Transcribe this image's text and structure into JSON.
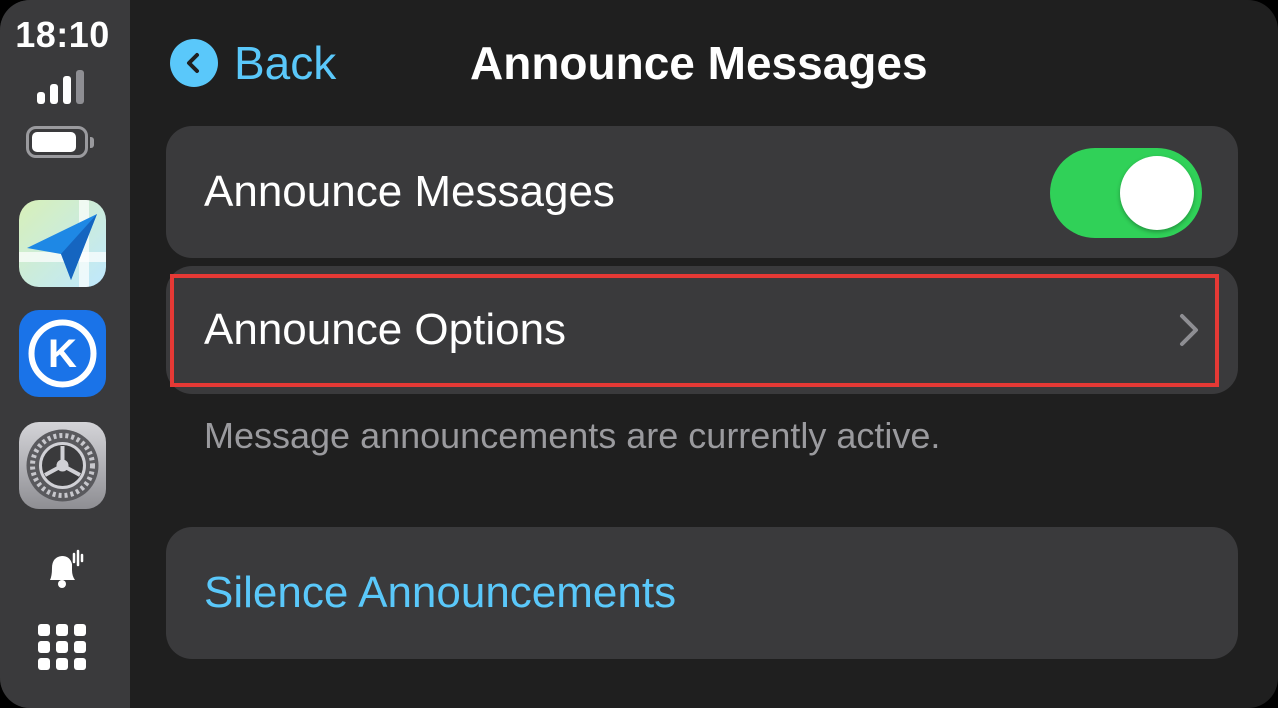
{
  "status": {
    "time": "18:10"
  },
  "sidebar": {
    "apps": [
      {
        "icon": "navigation-app-icon"
      },
      {
        "icon": "kiwi-k-app-icon"
      },
      {
        "icon": "settings-gear-app-icon"
      }
    ],
    "notification_icon": "bell-sound-icon",
    "home_icon": "app-grid-icon"
  },
  "header": {
    "back_label": "Back",
    "title": "Announce Messages"
  },
  "settings": {
    "announce_messages": {
      "label": "Announce Messages",
      "enabled": true
    },
    "announce_options": {
      "label": "Announce Options"
    },
    "footer": "Message announcements are currently active.",
    "silence": {
      "label": "Silence Announcements"
    }
  },
  "colors": {
    "accent": "#5ac8fa",
    "toggle_on": "#30d158",
    "highlight": "#e53935",
    "card_bg": "#3a3a3c"
  }
}
